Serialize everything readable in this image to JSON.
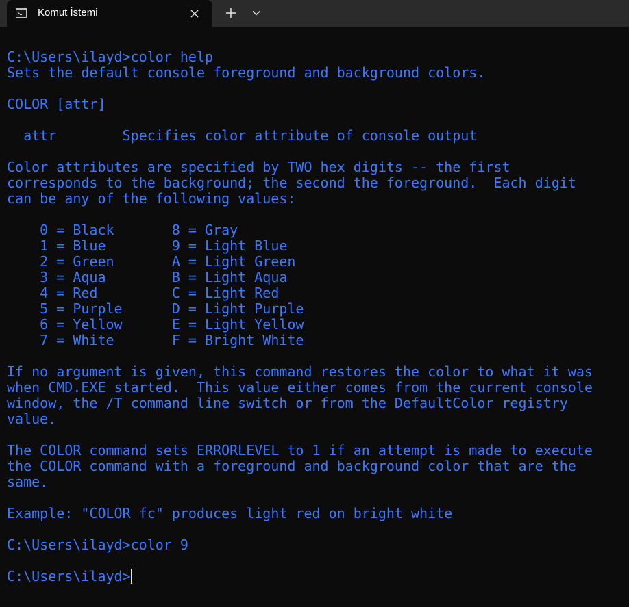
{
  "window": {
    "tab_title": "Komut İstemi",
    "icons": {
      "tab": "terminal-icon",
      "close": "close-icon",
      "new_tab": "plus-icon",
      "dropdown": "chevron-down-icon"
    }
  },
  "colors": {
    "background": "#0c0c0c",
    "text": "#3b78ff",
    "titlebar": "#2b2b2b",
    "cursor": "#e6e6e6"
  },
  "terminal": {
    "lines": [
      "C:\\Users\\ilayd>color help",
      "Sets the default console foreground and background colors.",
      "",
      "COLOR [attr]",
      "",
      "  attr        Specifies color attribute of console output",
      "",
      "Color attributes are specified by TWO hex digits -- the first",
      "corresponds to the background; the second the foreground.  Each digit",
      "can be any of the following values:",
      "",
      "    0 = Black       8 = Gray",
      "    1 = Blue        9 = Light Blue",
      "    2 = Green       A = Light Green",
      "    3 = Aqua        B = Light Aqua",
      "    4 = Red         C = Light Red",
      "    5 = Purple      D = Light Purple",
      "    6 = Yellow      E = Light Yellow",
      "    7 = White       F = Bright White",
      "",
      "If no argument is given, this command restores the color to what it was",
      "when CMD.EXE started.  This value either comes from the current console",
      "window, the /T command line switch or from the DefaultColor registry",
      "value.",
      "",
      "The COLOR command sets ERRORLEVEL to 1 if an attempt is made to execute",
      "the COLOR command with a foreground and background color that are the",
      "same.",
      "",
      "Example: \"COLOR fc\" produces light red on bright white",
      "",
      "C:\\Users\\ilayd>color 9",
      ""
    ],
    "prompt": "C:\\Users\\ilayd>"
  }
}
